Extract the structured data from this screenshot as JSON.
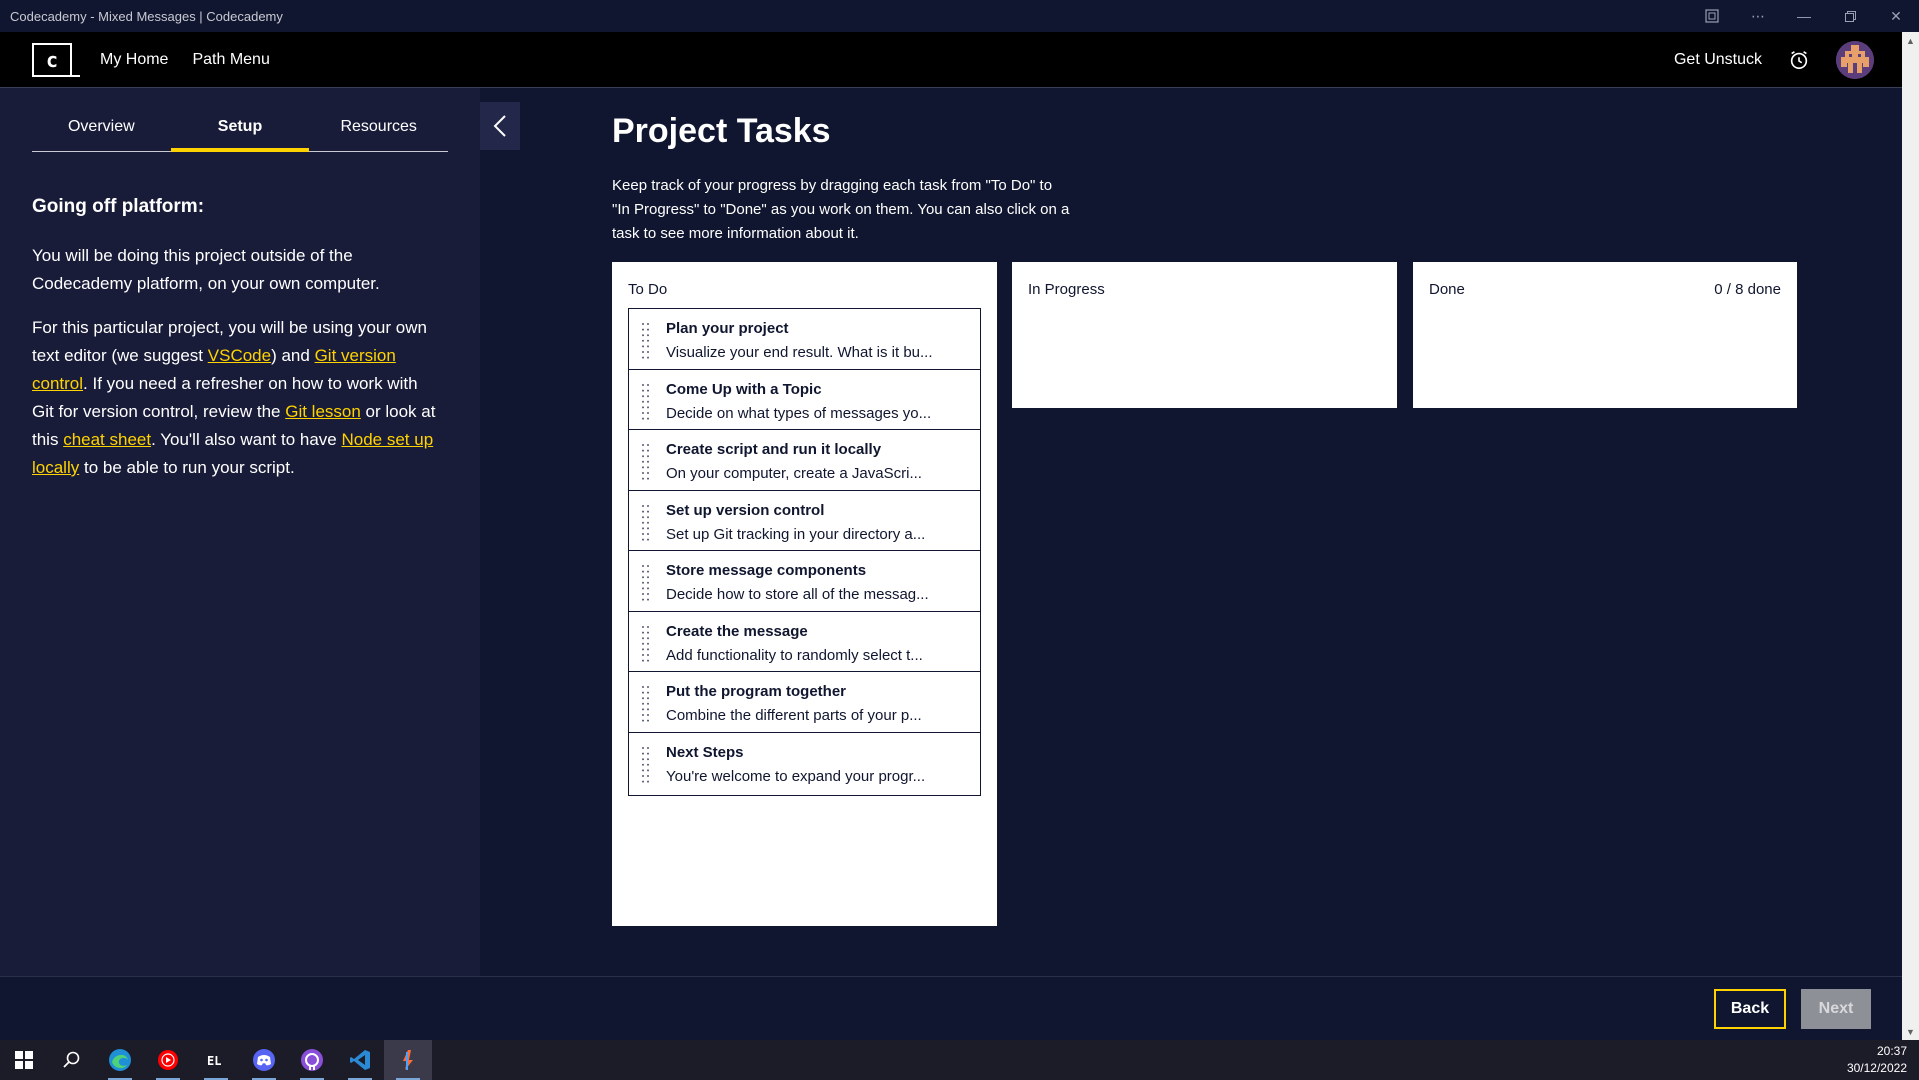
{
  "window": {
    "title": "Codecademy - Mixed Messages | Codecademy"
  },
  "header": {
    "logo_text": "c",
    "nav": [
      "My Home",
      "Path Menu"
    ],
    "get_unstuck": "Get Unstuck"
  },
  "left_panel": {
    "tabs": [
      {
        "label": "Overview",
        "active": false
      },
      {
        "label": "Setup",
        "active": true
      },
      {
        "label": "Resources",
        "active": false
      }
    ],
    "heading": "Going off platform:",
    "para1": "You will be doing this project outside of the Codecademy platform, on your own computer.",
    "para2": {
      "t1": "For this particular project, you will be using your own text editor (we suggest ",
      "link_vscode": "VSCode",
      "t2": ") and ",
      "link_git": "Git version control",
      "t3": ". If you need a refresher on how to work with Git for version control, review the ",
      "link_git_lesson": "Git lesson",
      "t4": " or look at this ",
      "link_cheat": "cheat sheet",
      "t5": ". You'll also want to have ",
      "link_node": "Node set up locally",
      "t6": " to be able to run your script."
    }
  },
  "main": {
    "title": "Project Tasks",
    "description": "Keep track of your progress by dragging each task from \"To Do\" to \"In Progress\" to \"Done\" as you work on them. You can also click on a task to see more information about it.",
    "columns": {
      "todo": "To Do",
      "in_progress": "In Progress",
      "done": "Done",
      "done_count": "0 / 8 done"
    },
    "tasks": [
      {
        "title": "Plan your project",
        "desc": "Visualize your end result. What is it bu..."
      },
      {
        "title": "Come Up with a Topic",
        "desc": "Decide on what types of messages yo..."
      },
      {
        "title": "Create script and run it locally",
        "desc": "On your computer, create a JavaScri..."
      },
      {
        "title": "Set up version control",
        "desc": "Set up Git tracking in your directory a..."
      },
      {
        "title": "Store message components",
        "desc": "Decide how to store all of the messag..."
      },
      {
        "title": "Create the message",
        "desc": "Add functionality to randomly select t..."
      },
      {
        "title": "Put the program together",
        "desc": "Combine the different parts of your p..."
      },
      {
        "title": "Next Steps",
        "desc": "You're welcome to expand your progr..."
      }
    ]
  },
  "footer": {
    "back": "Back",
    "next": "Next"
  },
  "taskbar": {
    "apps": [
      "start-icon",
      "search-icon",
      "edge-icon",
      "youtube-music-icon",
      "electron-app-icon",
      "discord-icon",
      "github-desktop-icon",
      "vscode-icon",
      "postman-icon"
    ],
    "time": "20:37",
    "date": "30/12/2022"
  },
  "colors": {
    "navy": "#10162f",
    "panel": "#181c39",
    "yellow": "#ffd300"
  }
}
